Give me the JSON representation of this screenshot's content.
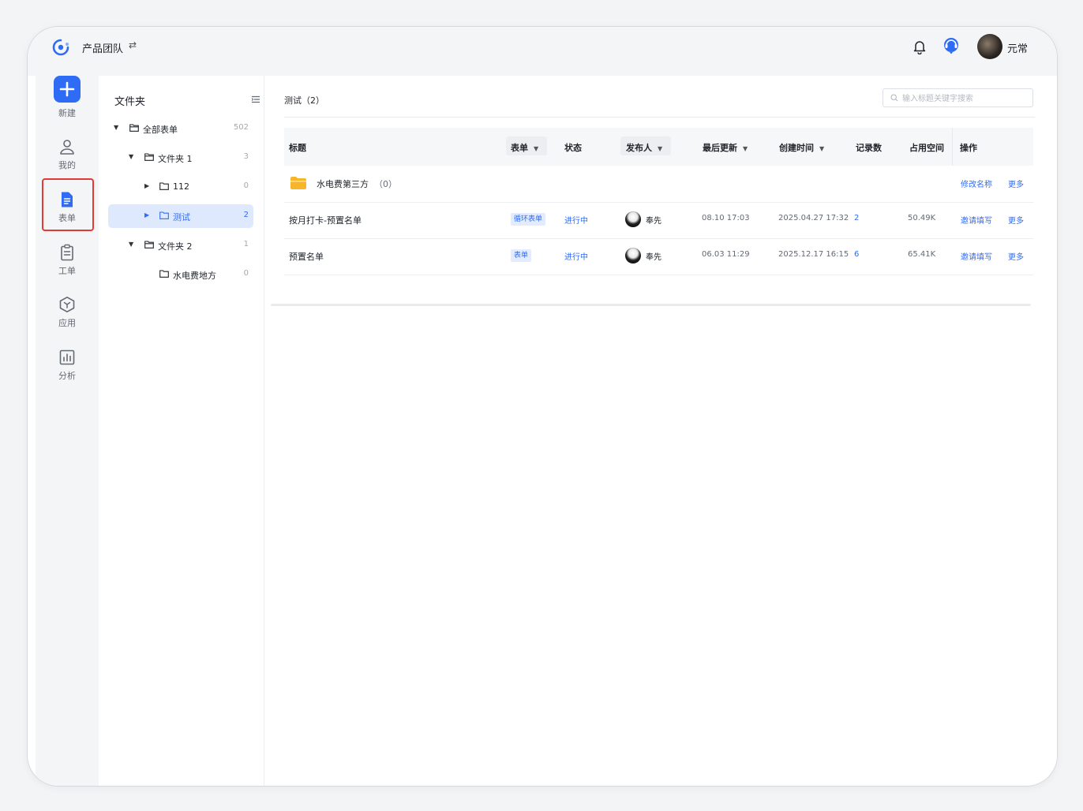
{
  "header": {
    "team_name": "产品团队",
    "switch_icon": "⇄",
    "user_name": "元常"
  },
  "nav": [
    {
      "label": "新建",
      "icon": "plus-icon"
    },
    {
      "label": "我的",
      "icon": "user-icon"
    },
    {
      "label": "表单",
      "icon": "form-icon",
      "active": true
    },
    {
      "label": "工单",
      "icon": "clipboard-icon"
    },
    {
      "label": "应用",
      "icon": "hexagon-icon"
    },
    {
      "label": "分析",
      "icon": "bar-chart-icon"
    }
  ],
  "folders": {
    "title": "文件夹",
    "tree": [
      {
        "name": "全部表单",
        "count": "502",
        "expanded": true
      },
      {
        "name": "文件夹 1",
        "count": "3",
        "expanded": true
      },
      {
        "name": "112",
        "count": "0",
        "expanded": false
      },
      {
        "name": "测试",
        "count": "2",
        "expanded": false,
        "active": true
      },
      {
        "name": "文件夹 2",
        "count": "1",
        "expanded": true
      },
      {
        "name": "水电费地方",
        "count": "0"
      }
    ]
  },
  "main": {
    "breadcrumb": "测试（2）",
    "search_placeholder": "输入标题关键字搜索",
    "columns": {
      "title": "标题",
      "form": "表单",
      "status": "状态",
      "publisher": "发布人",
      "last_update": "最后更新",
      "created": "创建时间",
      "records": "记录数",
      "space": "占用空间",
      "actions": "操作"
    },
    "folder_row": {
      "name": "水电费第三方",
      "count": "（0）",
      "action_rename": "修改名称",
      "action_more": "更多"
    },
    "rows": [
      {
        "title": "按月打卡-预置名单",
        "form_type": "循环表单",
        "status": "进行中",
        "publisher": "奉先",
        "last_update": "08.10 17:03",
        "created": "2025.04.27 17:32",
        "records": "2",
        "space": "50.49K",
        "action_invite": "邀请填写",
        "action_more": "更多"
      },
      {
        "title": "预置名单",
        "form_type": "表单",
        "status": "进行中",
        "publisher": "奉先",
        "last_update": "06.03 11:29",
        "created": "2025.12.17 16:15",
        "records": "6",
        "space": "65.41K",
        "action_invite": "邀请填写",
        "action_more": "更多"
      }
    ]
  },
  "colors": {
    "accent": "#2f6cf6",
    "active_bg": "#dfe9fe",
    "folder_yellow": "#f7b52c",
    "highlight_border": "#e53935"
  }
}
